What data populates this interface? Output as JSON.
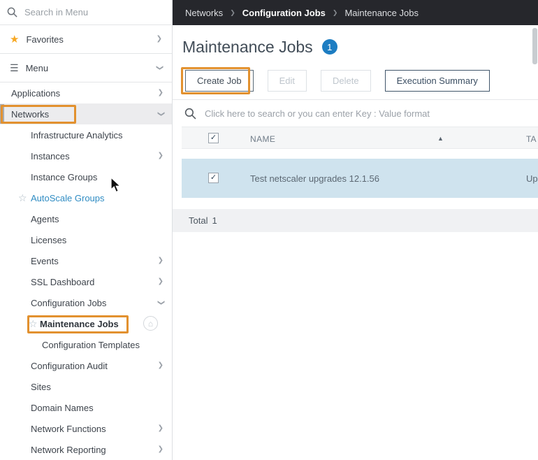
{
  "icons": {
    "star": "★",
    "star_outline": "☆",
    "menu": "☰",
    "chevron": "❯",
    "sort_asc": "▲",
    "check": "✓",
    "home": "⌂"
  },
  "colors": {
    "annotation_orange": "#e2912f",
    "topbar_dark": "#26272c",
    "badge_blue": "#1d7dc2",
    "selected_row_blue": "#cfe3ee",
    "link_blue": "#2f8cc3"
  },
  "sidebar": {
    "search_placeholder": "Search in Menu",
    "favorites_label": "Favorites",
    "menu_label": "Menu",
    "items": [
      {
        "label": "Applications"
      },
      {
        "label": "Networks"
      },
      {
        "label": "Infrastructure Analytics"
      },
      {
        "label": "Instances"
      },
      {
        "label": "Instance Groups"
      },
      {
        "label": "AutoScale Groups"
      },
      {
        "label": "Agents"
      },
      {
        "label": "Licenses"
      },
      {
        "label": "Events"
      },
      {
        "label": "SSL Dashboard"
      },
      {
        "label": "Configuration Jobs"
      },
      {
        "label": "Maintenance Jobs"
      },
      {
        "label": "Configuration Templates"
      },
      {
        "label": "Configuration Audit"
      },
      {
        "label": "Sites"
      },
      {
        "label": "Domain Names"
      },
      {
        "label": "Network Functions"
      },
      {
        "label": "Network Reporting"
      }
    ]
  },
  "header": {
    "breadcrumb": [
      "Networks",
      "Configuration Jobs",
      "Maintenance Jobs"
    ]
  },
  "main": {
    "title": "Maintenance Jobs",
    "badge": "1",
    "buttons": {
      "create": "Create Job",
      "edit": "Edit",
      "delete": "Delete",
      "execution_summary": "Execution Summary"
    },
    "search_placeholder": "Click here to search or you can enter Key : Value format",
    "table": {
      "columns": [
        "NAME",
        "TA"
      ],
      "rows": [
        {
          "name": "Test netscaler upgrades 12.1.56",
          "ta": "Up"
        }
      ],
      "total_label": "Total",
      "total_value": "1"
    }
  }
}
